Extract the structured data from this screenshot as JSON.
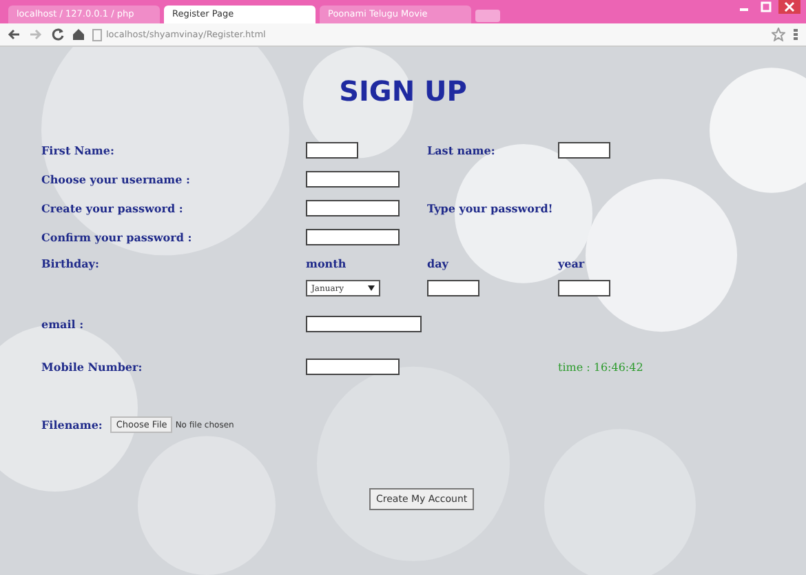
{
  "browser": {
    "tabs": [
      {
        "label": "localhost / 127.0.0.1 / php",
        "selected": false
      },
      {
        "label": "Register Page",
        "selected": true
      },
      {
        "label": "Poonami Telugu Movie",
        "selected": false
      }
    ],
    "address": "localhost/shyamvinay/Register.html"
  },
  "page": {
    "title": "SIGN UP",
    "rows": [
      [
        {
          "kind": "label",
          "text": "First Name:"
        },
        {
          "kind": "short"
        },
        {
          "kind": "label",
          "text": "Last name:"
        },
        {
          "kind": "short"
        }
      ],
      [
        {
          "kind": "label",
          "text": "Choose your username :"
        },
        {
          "kind": "medium"
        }
      ],
      [
        {
          "kind": "label",
          "text": "Create your password :"
        },
        {
          "kind": "medium"
        },
        {
          "kind": "label",
          "text": "Type your password!"
        }
      ],
      [
        {
          "kind": "label",
          "text": "Confirm your password :"
        },
        {
          "kind": "medium"
        }
      ],
      [
        {
          "kind": "label",
          "text": "Birthday:"
        },
        {
          "kind": "label",
          "text": "month"
        },
        {
          "kind": "label",
          "text": "day"
        },
        {
          "kind": "label",
          "text": "year"
        }
      ],
      [
        {
          "kind": "empty"
        },
        {
          "kind": "select",
          "value": "January"
        },
        {
          "kind": "short"
        },
        {
          "kind": "short"
        }
      ],
      [
        {
          "kind": "label",
          "text": "email :"
        },
        {
          "kind": "long"
        }
      ],
      [
        {
          "kind": "label",
          "text": "Mobile Number:"
        },
        {
          "kind": "medium"
        },
        {
          "kind": "empty"
        },
        {
          "kind": "time",
          "text": "time : 16:46:42"
        }
      ]
    ],
    "file": {
      "label": "Filename:",
      "button": "Choose File",
      "status": "No file chosen"
    },
    "submit": "Create My Account"
  }
}
